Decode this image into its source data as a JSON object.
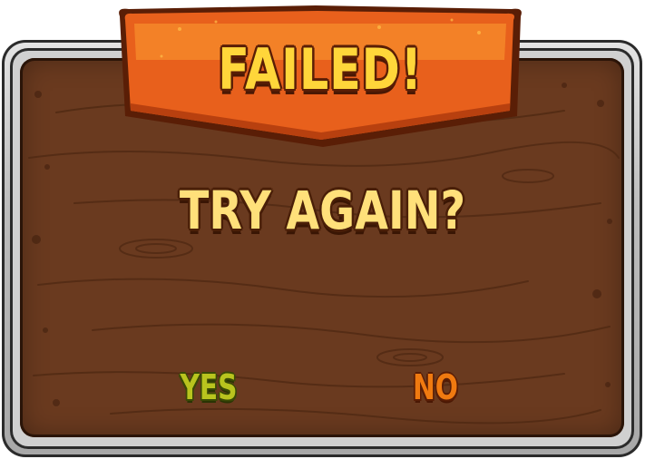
{
  "dialog": {
    "title": "FAILED!",
    "prompt": "TRY AGAIN?",
    "yes_label": "YES",
    "no_label": "NO"
  },
  "colors": {
    "banner_orange": "#e8601c",
    "title_yellow": "#ffd63a",
    "prompt_yellow": "#ffe07a",
    "yes_green": "#b9c41e",
    "no_orange": "#f07a10",
    "wood_brown": "#6a3a1f",
    "frame_gray": "#bdbdbd"
  }
}
